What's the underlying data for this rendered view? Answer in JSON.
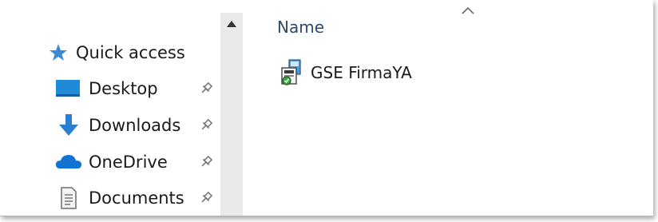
{
  "navigation": {
    "items": [
      {
        "label": "Quick access",
        "icon": "star-icon"
      },
      {
        "label": "Desktop",
        "icon": "desktop-icon",
        "pinned": true
      },
      {
        "label": "Downloads",
        "icon": "download-arrow-icon",
        "pinned": true
      },
      {
        "label": "OneDrive",
        "icon": "cloud-icon",
        "pinned": true
      },
      {
        "label": "Documents",
        "icon": "document-icon",
        "pinned": true
      }
    ]
  },
  "file_list": {
    "column_header": "Name",
    "files": [
      {
        "name": "GSE FirmaYA",
        "icon": "installer-icon"
      }
    ]
  },
  "colors": {
    "star": "#3a8ad6",
    "desktop": "#1f8ad8",
    "downloads": "#2a7fd4",
    "onedrive": "#1174d3",
    "scrollbar": "#e9e9e9",
    "header_text": "#2d4a6b"
  }
}
